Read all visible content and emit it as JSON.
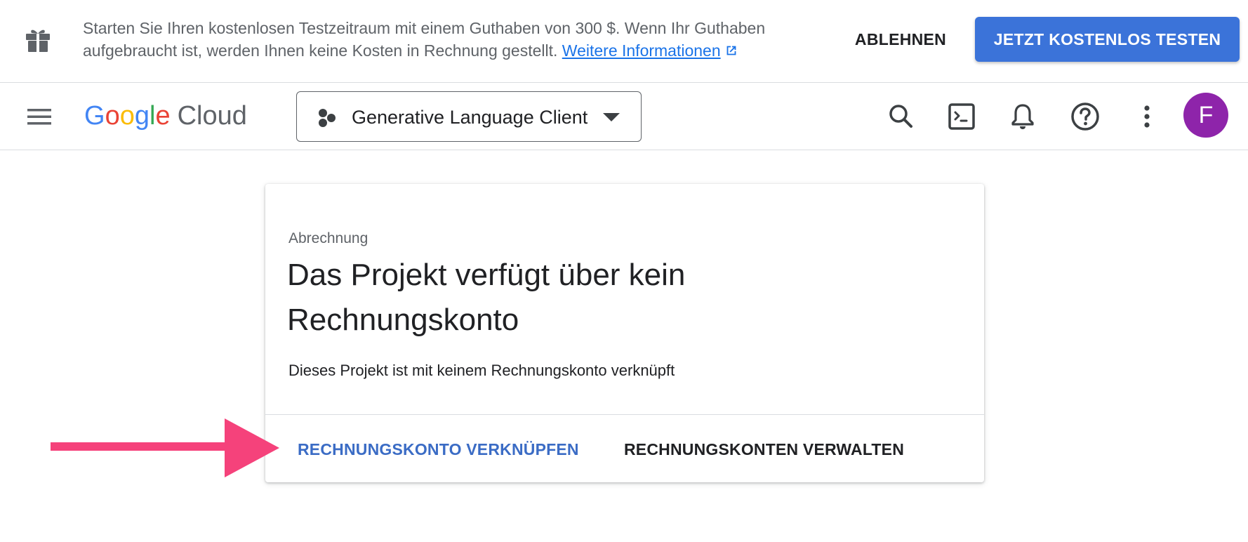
{
  "promo": {
    "text": "Starten Sie Ihren kostenlosen Testzeitraum mit einem Guthaben von 300 $. Wenn Ihr Guthaben aufgebraucht ist, werden Ihnen keine Kosten in Rechnung gestellt.",
    "link_label": "Weitere Informationen",
    "dismiss_label": "ABLEHNEN",
    "trial_label": "JETZT KOSTENLOS TESTEN"
  },
  "header": {
    "logo_letters": [
      "G",
      "o",
      "o",
      "g",
      "l",
      "e"
    ],
    "logo_product": "Cloud",
    "project_name": "Generative Language Client",
    "avatar_initial": "F",
    "icons": [
      "menu-icon",
      "search-icon",
      "cloud-shell-icon",
      "bell-icon",
      "help-icon",
      "more-vert-icon"
    ]
  },
  "card": {
    "eyebrow": "Abrechnung",
    "title": "Das Projekt verfügt über kein Rechnungskonto",
    "description": "Dieses Projekt ist mit keinem Rechnungskonto verknüpft",
    "link_account_label": "RECHNUNGSKONTO VERKNÜPFEN",
    "manage_accounts_label": "RECHNUNGSKONTEN VERWALTEN"
  },
  "colors": {
    "primary_button": "#3b73d9",
    "link_blue": "#3b6cc5",
    "avatar": "#8e24aa",
    "annotation_arrow": "#f5427b"
  }
}
